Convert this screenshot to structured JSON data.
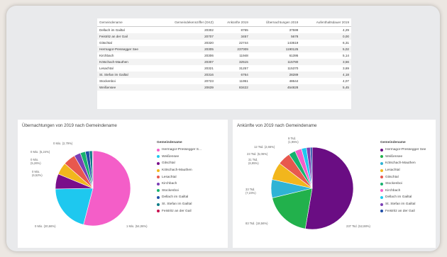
{
  "table": {
    "headers": [
      "Gemeindename",
      "Gemeindekennziffer (GKZ)",
      "Ankünfte 2019",
      "Übernachtungen 2019",
      "Aufenthaltsdauer 2019"
    ],
    "rows": [
      [
        "Dellach im Gailtal",
        "20302",
        "8765",
        "37599",
        "4,29"
      ],
      [
        "Feistritz an der Gail",
        "20707",
        "3457",
        "5678",
        "0,00"
      ],
      [
        "Gitschtal",
        "20320",
        "22744",
        "143619",
        "6,31"
      ],
      [
        "Hermagor-Pressegger See",
        "20305",
        "237009",
        "1190125",
        "5,02"
      ],
      [
        "Kirchbach",
        "20306",
        "11948",
        "61395",
        "5,14"
      ],
      [
        "Kötschach-Mauthen",
        "20307",
        "32515",
        "115780",
        "3,56"
      ],
      [
        "Lesachtal",
        "20321",
        "31257",
        "115370",
        "3,69"
      ],
      [
        "St. Stefan im Gailtal",
        "20316",
        "6764",
        "28289",
        "4,18"
      ],
      [
        "Stockenboi",
        "20723",
        "11951",
        "48644",
        "4,07"
      ],
      [
        "Weißensee",
        "20639",
        "83422",
        "454828",
        "5,45"
      ]
    ]
  },
  "chart_left": {
    "title": "Übernachtungen von 2019 nach Gemeindename",
    "legend_title": "Gemeindename",
    "legend": [
      {
        "label": "Hermagor-Pressegger S...",
        "color": "#f45ec8"
      },
      {
        "label": "Weißensee",
        "color": "#1ec8ef"
      },
      {
        "label": "Gitschtal",
        "color": "#7a0e8a"
      },
      {
        "label": "Kötschach-Mauthen",
        "color": "#f2b61d"
      },
      {
        "label": "Lesachtal",
        "color": "#e8584e"
      },
      {
        "label": "Kirchbach",
        "color": "#7b3fb5"
      },
      {
        "label": "Stockenboi",
        "color": "#17b26e"
      },
      {
        "label": "Dellach im Gailtal",
        "color": "#1f4ea8"
      },
      {
        "label": "St. Stefan im Gailtal",
        "color": "#0d7c87"
      },
      {
        "label": "Feistritz an der Gail",
        "color": "#c8104f"
      }
    ],
    "labels": {
      "main": "1 Mio. (54,06%)",
      "second": "0 Mio. (20,66%)",
      "third": "0 Mio.\n(6,52%)",
      "fourth": "0 Mio.\n(5,26%)",
      "fifth": "0 Mio. (5,24%)",
      "sixth": "0 Mio. (2,79%)"
    }
  },
  "chart_right": {
    "title": "Ankünfte von 2019 nach Gemeindename",
    "legend_title": "Gemeindename",
    "legend": [
      {
        "label": "Hermagor-Pressegger See",
        "color": "#6a0d83"
      },
      {
        "label": "Weißensee",
        "color": "#22b14c"
      },
      {
        "label": "Kötschach-Mauthen",
        "color": "#2fb3d5"
      },
      {
        "label": "Lesachtal",
        "color": "#f2b61d"
      },
      {
        "label": "Gitschtal",
        "color": "#e8584e"
      },
      {
        "label": "Stockenboi",
        "color": "#17b26e"
      },
      {
        "label": "Kirchbach",
        "color": "#f45ec8"
      },
      {
        "label": "Dellach im Gailtal",
        "color": "#1ec8ef"
      },
      {
        "label": "St. Stefan im Gailtal",
        "color": "#7b3fb5"
      },
      {
        "label": "Feistritz an der Gail",
        "color": "#1f4ea8"
      }
    ],
    "labels": {
      "main": "237 Tsd. (52,88%)",
      "second": "83 Tsd. (18,56%)",
      "third": "33 Tsd.\n(7,23%)",
      "fourth": "31 Tsd.\n(6,95%)",
      "fifth": "23 Tsd. (5,06%)",
      "sixth": "12 Tsd. (2,66%)",
      "seventh": "9 Tsd.\n(1,95%)"
    }
  },
  "chart_data": [
    {
      "type": "pie",
      "title": "Übernachtungen von 2019 nach Gemeindename",
      "categories": [
        "Hermagor-Pressegger See",
        "Weißensee",
        "Gitschtal",
        "Kötschach-Mauthen",
        "Lesachtal",
        "Kirchbach",
        "Stockenboi",
        "Dellach im Gailtal",
        "St. Stefan im Gailtal",
        "Feistritz an der Gail"
      ],
      "values": [
        1190125,
        454828,
        143619,
        115780,
        115370,
        61395,
        48644,
        37599,
        28289,
        5678
      ],
      "percent_labels": [
        "54,06%",
        "20,66%",
        "6,52%",
        "5,26%",
        "5,24%",
        "2,79%"
      ],
      "legend": "right"
    },
    {
      "type": "pie",
      "title": "Ankünfte von 2019 nach Gemeindename",
      "categories": [
        "Hermagor-Pressegger See",
        "Weißensee",
        "Kötschach-Mauthen",
        "Lesachtal",
        "Gitschtal",
        "Stockenboi",
        "Kirchbach",
        "Dellach im Gailtal",
        "St. Stefan im Gailtal",
        "Feistritz an der Gail"
      ],
      "values": [
        237009,
        83422,
        32515,
        31257,
        22744,
        11951,
        11948,
        8765,
        6764,
        3457
      ],
      "percent_labels": [
        "52,88%",
        "18,56%",
        "7,23%",
        "6,95%",
        "5,06%",
        "2,66%",
        "1,95%"
      ],
      "legend": "right"
    }
  ]
}
